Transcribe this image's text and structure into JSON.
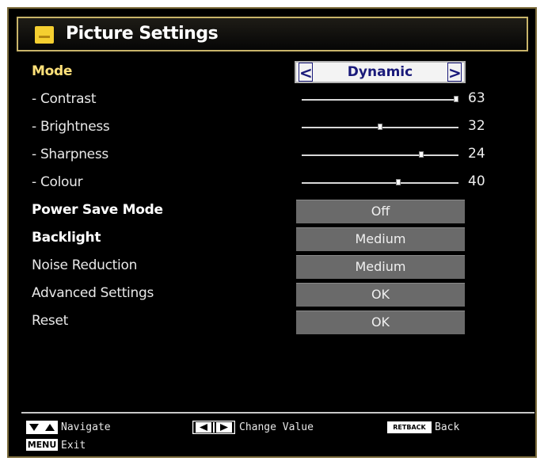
{
  "header": {
    "title": "Picture Settings",
    "icon": "picture-icon"
  },
  "mode": {
    "label": "Mode",
    "value": "Dynamic",
    "left_arrow": "<",
    "right_arrow": ">"
  },
  "sliders": [
    {
      "label": "- Contrast",
      "value": "63",
      "level": 1.0
    },
    {
      "label": "- Brightness",
      "value": "32",
      "level": 0.5
    },
    {
      "label": "- Sharpness",
      "value": "24",
      "level": 0.77
    },
    {
      "label": "- Colour",
      "value": "40",
      "level": 0.62
    }
  ],
  "options": [
    {
      "label": "Power Save Mode",
      "value": "Off"
    },
    {
      "label": "Backlight",
      "value": "Medium"
    },
    {
      "label": "Noise Reduction",
      "value": "Medium"
    },
    {
      "label": "Advanced Settings",
      "value": "OK"
    },
    {
      "label": "Reset",
      "value": "OK"
    }
  ],
  "footer": {
    "navigate": "Navigate",
    "change_value": "Change Value",
    "back_key": "RETBACK",
    "back": "Back",
    "menu_key": "MENU",
    "exit": "Exit"
  },
  "colors": {
    "highlight_label": "#ffe17a",
    "value_box": "#6a6a6a",
    "frame": "#c8b46a"
  }
}
